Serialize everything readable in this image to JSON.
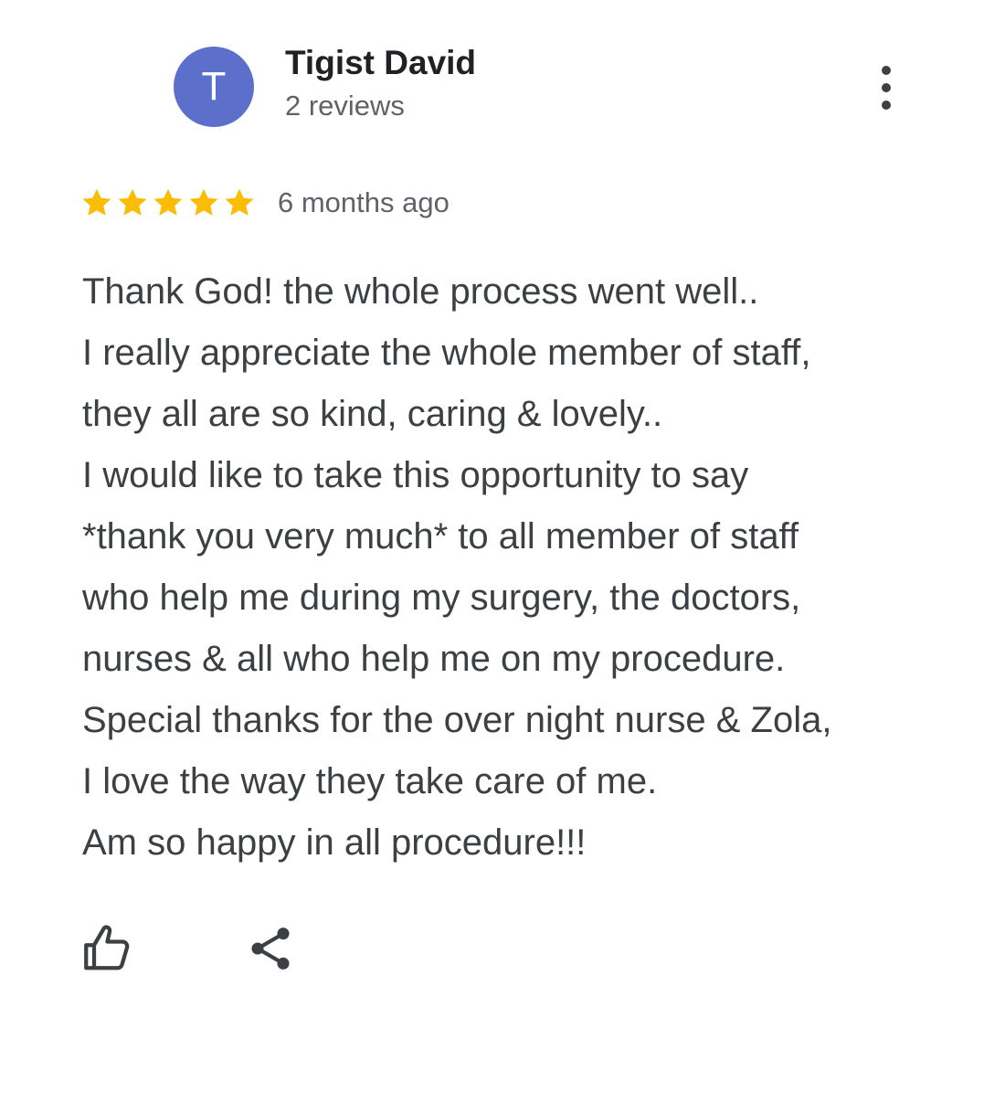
{
  "reviewer": {
    "initial": "T",
    "name": "Tigist David",
    "review_count": "2 reviews",
    "avatar_color": "#5b6fcb"
  },
  "menu": {
    "icon": "more-vert-icon"
  },
  "rating": {
    "stars": 5,
    "max_stars": 5,
    "star_color": "#fbbc04",
    "date": "6 months ago"
  },
  "review": {
    "lines": [
      "Thank God! the whole process went well..",
      "I really appreciate the whole member of staff,",
      "they all are so kind, caring & lovely..",
      "I would like to take this opportunity to say",
      "*thank you very much* to all member of staff",
      "who help me during my surgery, the doctors,",
      "nurses & all who help me on my procedure.",
      "Special thanks for the over night nurse & Zola,",
      "I love the way they take care of me.",
      "Am so happy in all procedure!!!"
    ]
  },
  "actions": {
    "like_icon": "thumb-up-icon",
    "share_icon": "share-icon"
  }
}
